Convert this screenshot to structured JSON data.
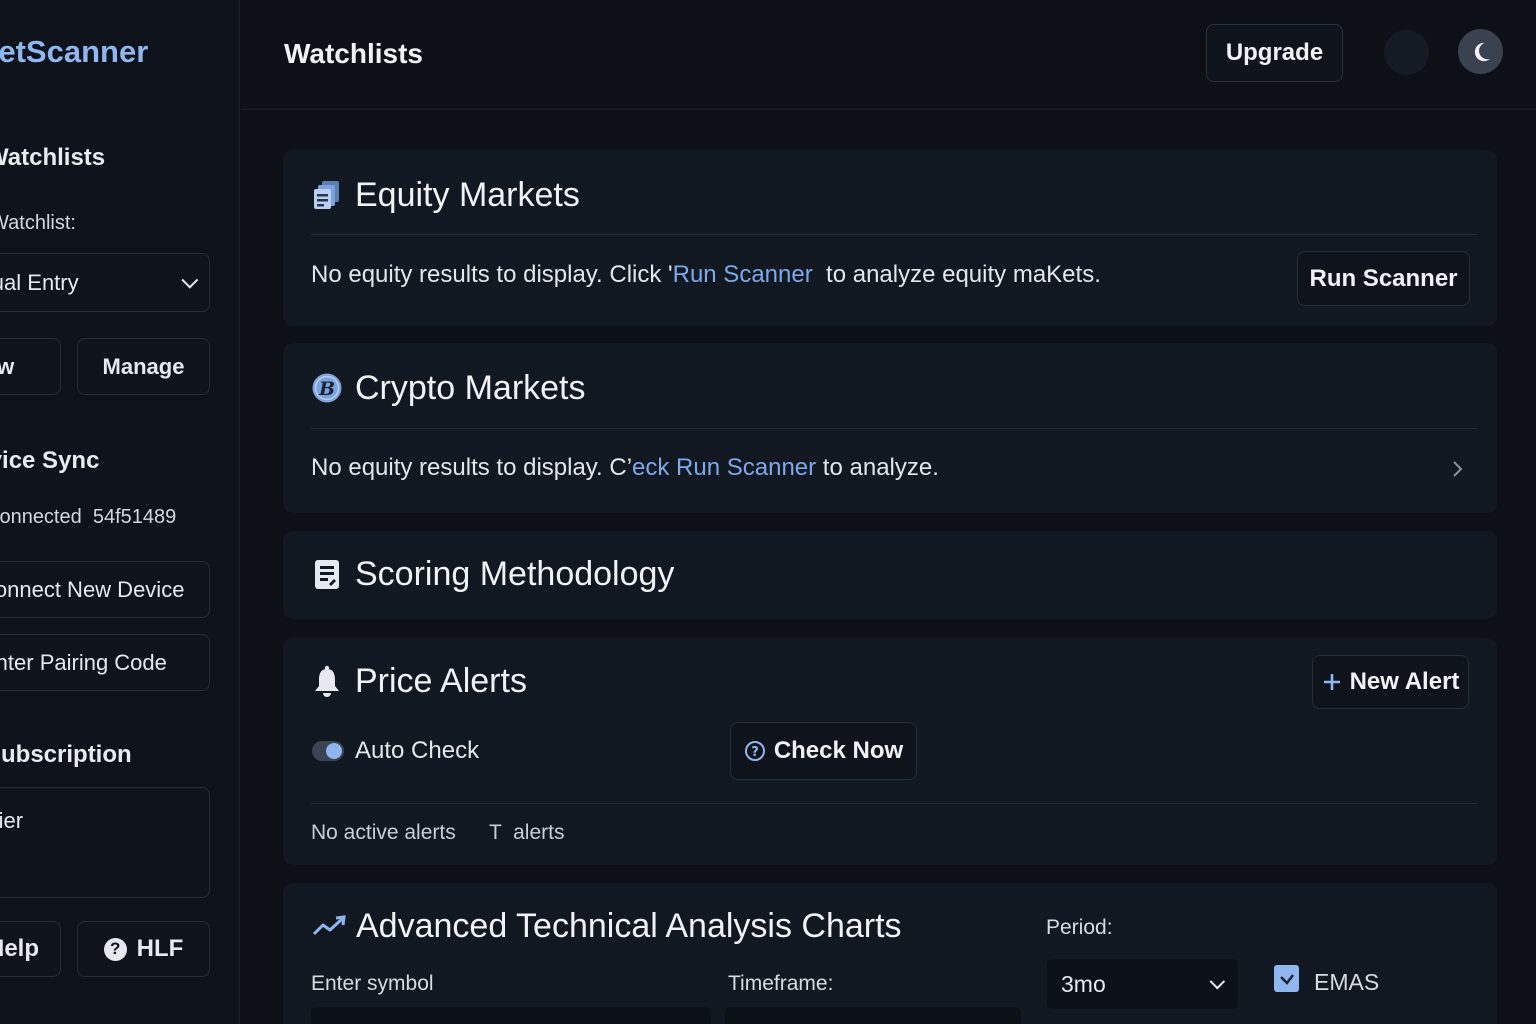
{
  "sidebar": {
    "brand": "MarketScanner",
    "watchlists_heading": "Watchlists",
    "watchlist_label": "Watchlist:",
    "watchlist_selected": "Manual Entry",
    "new_button": "New",
    "manage_button": "Manage",
    "device_sync_heading": "Device Sync",
    "connected_status": "Connected",
    "device_id": "54f51489",
    "connect_button": "Connect New Device",
    "pairing_button": "Enter Pairing Code",
    "subscription_heading": "Subscription",
    "tier_label": "Free Tier",
    "help_button": "Help",
    "hlf_button": "HLF"
  },
  "header": {
    "title": "Watchlists",
    "upgrade_button": "Upgrade"
  },
  "equity": {
    "title": "Equity Markets",
    "text_before": "No equity results to display. Click '",
    "link": "Run Scanner",
    "text_after": "  to analyze equity maKets.",
    "run_button": "Run Scanner"
  },
  "crypto": {
    "title": "Crypto Markets",
    "text_before": "No equity results to display. C’",
    "link": "eck Run Scanner",
    "text_after": " to analyze."
  },
  "scoring": {
    "title": "Scoring Methodology"
  },
  "alerts": {
    "title": "Price Alerts",
    "new_alert_button": "New Alert",
    "auto_check_label": "Auto Check",
    "auto_check_on": true,
    "check_now_button": "Check Now",
    "no_active": "No active alerts",
    "total_alerts": "T  alerts"
  },
  "charts": {
    "title": "Advanced Technical Analysis Charts",
    "symbol_label": "Enter symbol",
    "timeframe_label": "Timeframe:",
    "period_label": "Period:",
    "period_value": "3mo",
    "emas_label": "EMAS",
    "emas_checked": true
  },
  "colors": {
    "accent": "#8fb6ee",
    "link": "#7fa8e8",
    "background": "#0d1117",
    "card": "#121822"
  },
  "icons": {
    "equity": "document-stack-icon",
    "crypto": "bitcoin-icon",
    "scoring": "clipboard-icon",
    "alerts": "bell-icon",
    "charts": "trend-line-icon",
    "theme": "moon-icon"
  }
}
